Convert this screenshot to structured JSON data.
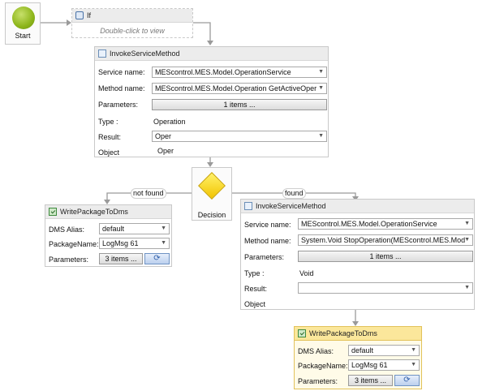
{
  "start": {
    "label": "Start"
  },
  "if_activity": {
    "title": "If",
    "hint": "Double-click to view"
  },
  "invoke1": {
    "title": "InvokeServiceMethod",
    "service_label": "Service name:",
    "service_value": "MEScontrol.MES.Model.OperationService",
    "method_label": "Method name:",
    "method_value": "MEScontrol.MES.Model.Operation GetActiveOper",
    "params_label": "Parameters:",
    "params_button": "1 items ...",
    "type_label": "Type :",
    "type_value": "Operation",
    "result_label": "Result:",
    "result_value": "Oper",
    "object_label": "Object",
    "object_value": "Oper"
  },
  "decision": {
    "label": "Decision"
  },
  "edges": {
    "not_found": "not found",
    "found": "found"
  },
  "write1": {
    "title": "WritePackageToDms",
    "dms_label": "DMS Alias:",
    "dms_value": "default",
    "pkg_label": "PackageName:",
    "pkg_value": "LogMsg 61",
    "params_label": "Parameters:",
    "params_button": "3 items ..."
  },
  "invoke2": {
    "title": "InvokeServiceMethod",
    "service_label": "Service name:",
    "service_value": "MEScontrol.MES.Model.OperationService",
    "method_label": "Method name:",
    "method_value": "System.Void StopOperation(MEScontrol.MES.Mod",
    "params_label": "Parameters:",
    "params_button": "1 items ...",
    "type_label": "Type :",
    "type_value": "Void",
    "result_label": "Result:",
    "result_value": "",
    "object_label": "Object"
  },
  "write2": {
    "title": "WritePackageToDms",
    "dms_label": "DMS Alias:",
    "dms_value": "default",
    "pkg_label": "PackageName:",
    "pkg_value": "LogMsg 61",
    "params_label": "Parameters:",
    "params_button": "3 items ..."
  }
}
